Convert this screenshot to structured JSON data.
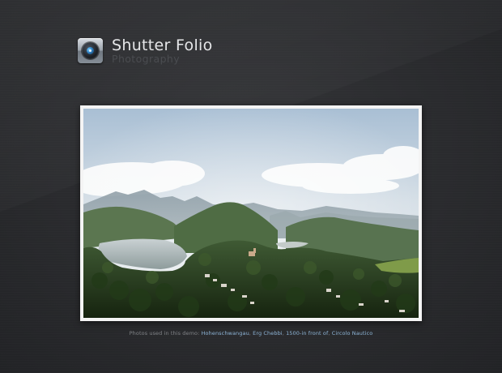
{
  "brand": {
    "title": "Shutter Folio",
    "subtitle": "Photography",
    "logo_icon": "camera-lens-icon"
  },
  "photo": {
    "description_icon": "landscape-photo"
  },
  "credits": {
    "prefix": "Photos used in this demo:",
    "links": [
      {
        "label": "Hohenschwangau"
      },
      {
        "label": "Erg Chebbi"
      },
      {
        "label": "1500-in front of"
      },
      {
        "label": "Circolo Nautico"
      }
    ]
  },
  "colors": {
    "background": "#2a2b2e",
    "title": "#e6e7e9",
    "subtitle": "#4a4c50",
    "link": "#8db4d6",
    "frame": "#f4f4f4"
  }
}
